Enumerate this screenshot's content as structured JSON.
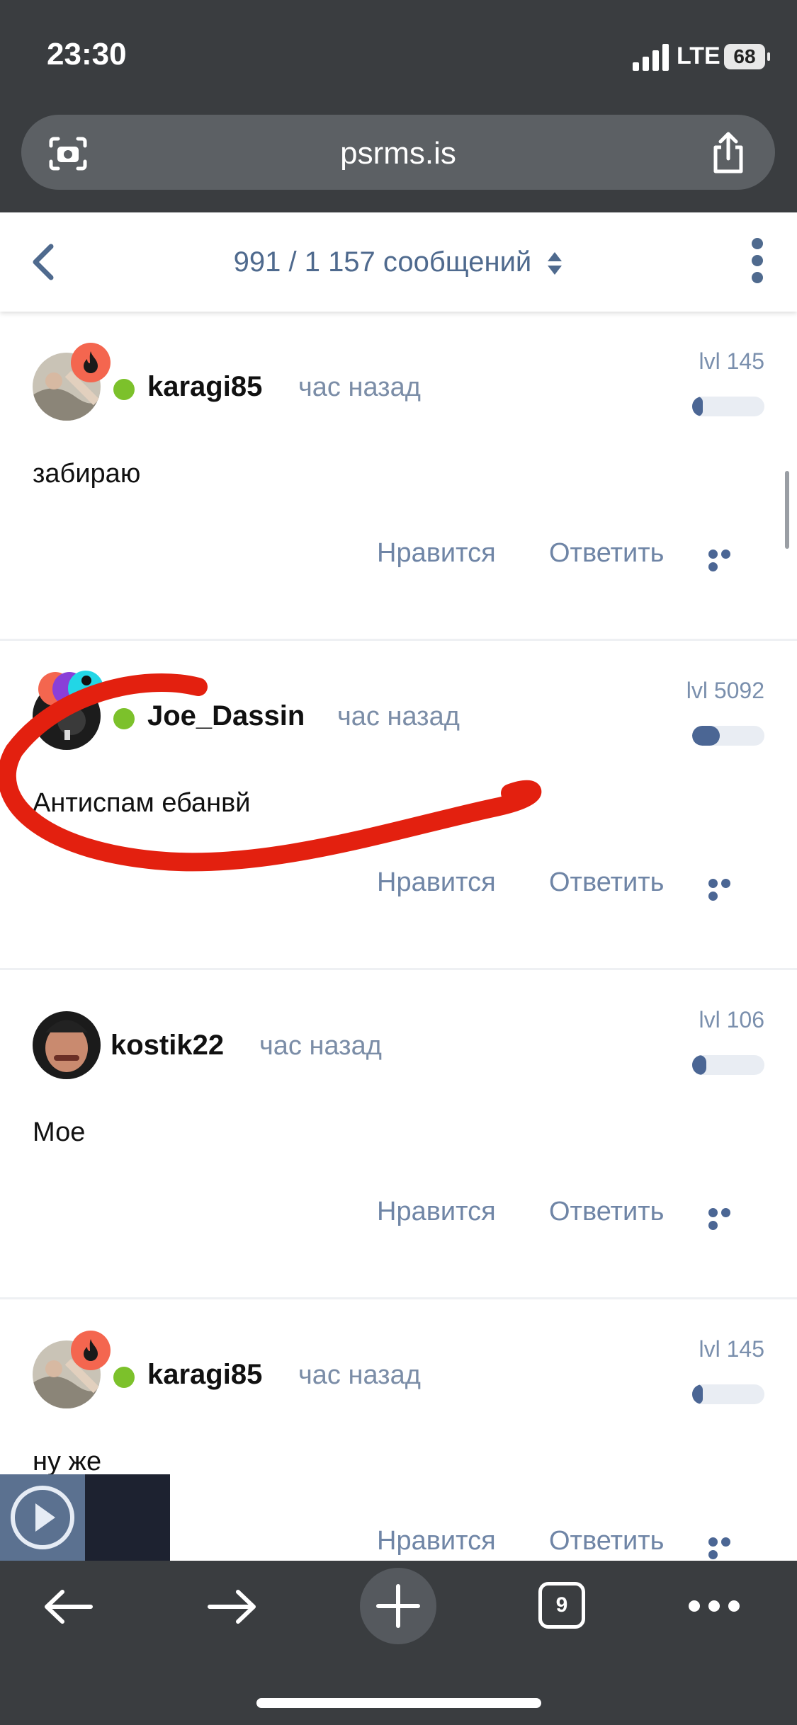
{
  "status": {
    "time": "23:30",
    "network": "LTE",
    "battery": "68"
  },
  "browser": {
    "url": "psrms.is",
    "tabs_count": "9"
  },
  "topic_nav": {
    "message_counter": "991 / 1 157 сообщений"
  },
  "posts": [
    {
      "author": "karagi85",
      "time": "час назад",
      "level": "lvl 145",
      "level_fill": 0.15,
      "text": "забираю",
      "like_label": "Нравится",
      "reply_label": "Ответить"
    },
    {
      "author": "Joe_Dassin",
      "time": "час назад",
      "level": "lvl 5092",
      "level_fill": 0.38,
      "text": "Антиспам ебанвй",
      "like_label": "Нравится",
      "reply_label": "Ответить"
    },
    {
      "author": "kostik22",
      "time": "час назад",
      "level": "lvl 106",
      "level_fill": 0.2,
      "text": "Мое",
      "like_label": "Нравится",
      "reply_label": "Ответить"
    },
    {
      "author": "karagi85",
      "time": "час назад",
      "level": "lvl 145",
      "level_fill": 0.15,
      "text": "ну же",
      "like_label": "Нравится",
      "reply_label": "Ответить"
    }
  ],
  "colors": {
    "accent": "#4f6a8e",
    "online": "#7cc12b",
    "badge_fire": "#f4664f",
    "scribble": "#e3200f"
  }
}
